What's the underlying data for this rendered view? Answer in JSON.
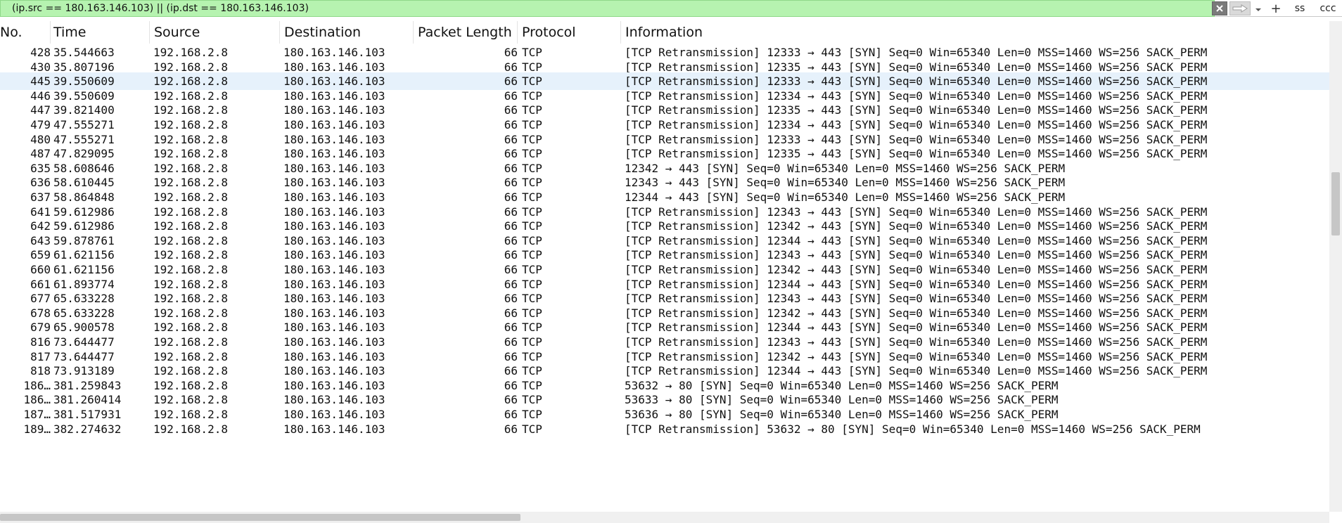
{
  "filter": {
    "value": "(ip.src == 180.163.146.103) || (ip.dst == 180.163.146.103)",
    "ss_label": "ss",
    "ccc_label": "ccc",
    "plus_label": "+"
  },
  "columns": [
    "No.",
    "Time",
    "Source",
    "Destination",
    "Packet Length",
    "Protocol",
    "Information"
  ],
  "selected_row_index": 2,
  "colors": {
    "filter_bg": "#b6f3b0",
    "selected_row": "#e6f1fb"
  },
  "rows": [
    {
      "no": "428",
      "time": "35.544663",
      "src": "192.168.2.8",
      "dst": "180.163.146.103",
      "len": "66",
      "proto": "TCP",
      "info": "[TCP Retransmission] 12333 → 443 [SYN] Seq=0 Win=65340 Len=0 MSS=1460 WS=256 SACK_PERM"
    },
    {
      "no": "430",
      "time": "35.807196",
      "src": "192.168.2.8",
      "dst": "180.163.146.103",
      "len": "66",
      "proto": "TCP",
      "info": "[TCP Retransmission] 12335 → 443 [SYN] Seq=0 Win=65340 Len=0 MSS=1460 WS=256 SACK_PERM"
    },
    {
      "no": "445",
      "time": "39.550609",
      "src": "192.168.2.8",
      "dst": "180.163.146.103",
      "len": "66",
      "proto": "TCP",
      "info": "[TCP Retransmission] 12333 → 443 [SYN] Seq=0 Win=65340 Len=0 MSS=1460 WS=256 SACK_PERM"
    },
    {
      "no": "446",
      "time": "39.550609",
      "src": "192.168.2.8",
      "dst": "180.163.146.103",
      "len": "66",
      "proto": "TCP",
      "info": "[TCP Retransmission] 12334 → 443 [SYN] Seq=0 Win=65340 Len=0 MSS=1460 WS=256 SACK_PERM"
    },
    {
      "no": "447",
      "time": "39.821400",
      "src": "192.168.2.8",
      "dst": "180.163.146.103",
      "len": "66",
      "proto": "TCP",
      "info": "[TCP Retransmission] 12335 → 443 [SYN] Seq=0 Win=65340 Len=0 MSS=1460 WS=256 SACK_PERM"
    },
    {
      "no": "479",
      "time": "47.555271",
      "src": "192.168.2.8",
      "dst": "180.163.146.103",
      "len": "66",
      "proto": "TCP",
      "info": "[TCP Retransmission] 12334 → 443 [SYN] Seq=0 Win=65340 Len=0 MSS=1460 WS=256 SACK_PERM"
    },
    {
      "no": "480",
      "time": "47.555271",
      "src": "192.168.2.8",
      "dst": "180.163.146.103",
      "len": "66",
      "proto": "TCP",
      "info": "[TCP Retransmission] 12333 → 443 [SYN] Seq=0 Win=65340 Len=0 MSS=1460 WS=256 SACK_PERM"
    },
    {
      "no": "487",
      "time": "47.829095",
      "src": "192.168.2.8",
      "dst": "180.163.146.103",
      "len": "66",
      "proto": "TCP",
      "info": "[TCP Retransmission] 12335 → 443 [SYN] Seq=0 Win=65340 Len=0 MSS=1460 WS=256 SACK_PERM"
    },
    {
      "no": "635",
      "time": "58.608646",
      "src": "192.168.2.8",
      "dst": "180.163.146.103",
      "len": "66",
      "proto": "TCP",
      "info": "12342 → 443 [SYN] Seq=0 Win=65340 Len=0 MSS=1460 WS=256 SACK_PERM"
    },
    {
      "no": "636",
      "time": "58.610445",
      "src": "192.168.2.8",
      "dst": "180.163.146.103",
      "len": "66",
      "proto": "TCP",
      "info": "12343 → 443 [SYN] Seq=0 Win=65340 Len=0 MSS=1460 WS=256 SACK_PERM"
    },
    {
      "no": "637",
      "time": "58.864848",
      "src": "192.168.2.8",
      "dst": "180.163.146.103",
      "len": "66",
      "proto": "TCP",
      "info": "12344 → 443 [SYN] Seq=0 Win=65340 Len=0 MSS=1460 WS=256 SACK_PERM"
    },
    {
      "no": "641",
      "time": "59.612986",
      "src": "192.168.2.8",
      "dst": "180.163.146.103",
      "len": "66",
      "proto": "TCP",
      "info": "[TCP Retransmission] 12343 → 443 [SYN] Seq=0 Win=65340 Len=0 MSS=1460 WS=256 SACK_PERM"
    },
    {
      "no": "642",
      "time": "59.612986",
      "src": "192.168.2.8",
      "dst": "180.163.146.103",
      "len": "66",
      "proto": "TCP",
      "info": "[TCP Retransmission] 12342 → 443 [SYN] Seq=0 Win=65340 Len=0 MSS=1460 WS=256 SACK_PERM"
    },
    {
      "no": "643",
      "time": "59.878761",
      "src": "192.168.2.8",
      "dst": "180.163.146.103",
      "len": "66",
      "proto": "TCP",
      "info": "[TCP Retransmission] 12344 → 443 [SYN] Seq=0 Win=65340 Len=0 MSS=1460 WS=256 SACK_PERM"
    },
    {
      "no": "659",
      "time": "61.621156",
      "src": "192.168.2.8",
      "dst": "180.163.146.103",
      "len": "66",
      "proto": "TCP",
      "info": "[TCP Retransmission] 12343 → 443 [SYN] Seq=0 Win=65340 Len=0 MSS=1460 WS=256 SACK_PERM"
    },
    {
      "no": "660",
      "time": "61.621156",
      "src": "192.168.2.8",
      "dst": "180.163.146.103",
      "len": "66",
      "proto": "TCP",
      "info": "[TCP Retransmission] 12342 → 443 [SYN] Seq=0 Win=65340 Len=0 MSS=1460 WS=256 SACK_PERM"
    },
    {
      "no": "661",
      "time": "61.893774",
      "src": "192.168.2.8",
      "dst": "180.163.146.103",
      "len": "66",
      "proto": "TCP",
      "info": "[TCP Retransmission] 12344 → 443 [SYN] Seq=0 Win=65340 Len=0 MSS=1460 WS=256 SACK_PERM"
    },
    {
      "no": "677",
      "time": "65.633228",
      "src": "192.168.2.8",
      "dst": "180.163.146.103",
      "len": "66",
      "proto": "TCP",
      "info": "[TCP Retransmission] 12343 → 443 [SYN] Seq=0 Win=65340 Len=0 MSS=1460 WS=256 SACK_PERM"
    },
    {
      "no": "678",
      "time": "65.633228",
      "src": "192.168.2.8",
      "dst": "180.163.146.103",
      "len": "66",
      "proto": "TCP",
      "info": "[TCP Retransmission] 12342 → 443 [SYN] Seq=0 Win=65340 Len=0 MSS=1460 WS=256 SACK_PERM"
    },
    {
      "no": "679",
      "time": "65.900578",
      "src": "192.168.2.8",
      "dst": "180.163.146.103",
      "len": "66",
      "proto": "TCP",
      "info": "[TCP Retransmission] 12344 → 443 [SYN] Seq=0 Win=65340 Len=0 MSS=1460 WS=256 SACK_PERM"
    },
    {
      "no": "816",
      "time": "73.644477",
      "src": "192.168.2.8",
      "dst": "180.163.146.103",
      "len": "66",
      "proto": "TCP",
      "info": "[TCP Retransmission] 12343 → 443 [SYN] Seq=0 Win=65340 Len=0 MSS=1460 WS=256 SACK_PERM"
    },
    {
      "no": "817",
      "time": "73.644477",
      "src": "192.168.2.8",
      "dst": "180.163.146.103",
      "len": "66",
      "proto": "TCP",
      "info": "[TCP Retransmission] 12342 → 443 [SYN] Seq=0 Win=65340 Len=0 MSS=1460 WS=256 SACK_PERM"
    },
    {
      "no": "818",
      "time": "73.913189",
      "src": "192.168.2.8",
      "dst": "180.163.146.103",
      "len": "66",
      "proto": "TCP",
      "info": "[TCP Retransmission] 12344 → 443 [SYN] Seq=0 Win=65340 Len=0 MSS=1460 WS=256 SACK_PERM"
    },
    {
      "no": "186…",
      "time": "381.259843",
      "src": "192.168.2.8",
      "dst": "180.163.146.103",
      "len": "66",
      "proto": "TCP",
      "info": "53632 → 80 [SYN] Seq=0 Win=65340 Len=0 MSS=1460 WS=256 SACK_PERM"
    },
    {
      "no": "186…",
      "time": "381.260414",
      "src": "192.168.2.8",
      "dst": "180.163.146.103",
      "len": "66",
      "proto": "TCP",
      "info": "53633 → 80 [SYN] Seq=0 Win=65340 Len=0 MSS=1460 WS=256 SACK_PERM"
    },
    {
      "no": "187…",
      "time": "381.517931",
      "src": "192.168.2.8",
      "dst": "180.163.146.103",
      "len": "66",
      "proto": "TCP",
      "info": "53636 → 80 [SYN] Seq=0 Win=65340 Len=0 MSS=1460 WS=256 SACK_PERM"
    },
    {
      "no": "189…",
      "time": "382.274632",
      "src": "192.168.2.8",
      "dst": "180.163.146.103",
      "len": "66",
      "proto": "TCP",
      "info": "[TCP Retransmission] 53632 → 80 [SYN] Seq=0 Win=65340 Len=0 MSS=1460 WS=256 SACK_PERM"
    }
  ]
}
